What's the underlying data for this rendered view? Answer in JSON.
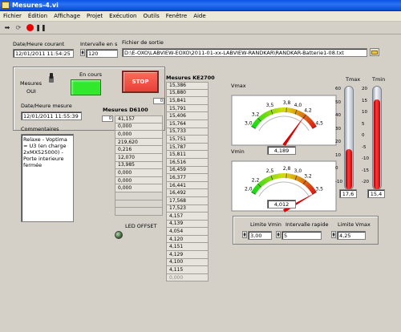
{
  "window": {
    "title": "Mesures-4.vi"
  },
  "menu": [
    "Fichier",
    "Édition",
    "Affichage",
    "Projet",
    "Exécution",
    "Outils",
    "Fenêtre",
    "Aide"
  ],
  "toolbar": {
    "run_icon": "run-arrow-icon",
    "continuous_icon": "continuous-run-icon",
    "abort_icon": "abort-icon",
    "pause_icon": "pause-icon"
  },
  "top": {
    "date_label": "Date/Heure courant",
    "date_value": "12/01/2011 11:54:25",
    "interval_label": "Intervalle en s",
    "interval_value": "120",
    "file_label": "Fichier de sortie",
    "file_value": "D:\\E-OXO\\LABVIEW-EOXO\\2011-01-xx-LABVIEW-RANDKAR\\RANDKAR-Batterie1-08.txt"
  },
  "left": {
    "mesures_label": "Mesures",
    "mesures_state": "OUI",
    "en_cours_label": "En cours",
    "stop_label": "STOP",
    "date_mesure_label": "Date/Heure mesure",
    "date_mesure_value": "12/01/2011 11:55:39",
    "comments_label": "Commentaires",
    "comments_text": "Relaxe - Voptima = U3 (en charge 2xMX525000) - Porte interieure fermée",
    "led_offset_label": "LED OFFSET"
  },
  "d6100": {
    "label": "Mesures D6100",
    "index": "0",
    "values": [
      "41,157",
      "0,000",
      "0,000",
      "219,620",
      "0,216",
      "12,070",
      "13,985",
      "0,000",
      "0,000",
      "0,000",
      "",
      "",
      ""
    ]
  },
  "ke2700": {
    "label": "Mesures KE2700",
    "index": "0",
    "values": [
      "15,386",
      "15,880",
      "15,841",
      "15,791",
      "15,406",
      "15,764",
      "15,733",
      "15,751",
      "15,787",
      "15,811",
      "16,516",
      "16,459",
      "16,377",
      "16,441",
      "16,492",
      "17,568",
      "17,523",
      "4,157",
      "4,139",
      "4,054",
      "4,120",
      "4,151",
      "4,129",
      "4,100",
      "4,115",
      "0,000"
    ]
  },
  "vmax": {
    "label": "Vmax",
    "ticks": [
      "3,0",
      "3,2",
      "3,5",
      "3,8",
      "4,0",
      "4,2",
      "4,5"
    ],
    "value": "4,189",
    "range": [
      3.0,
      4.5
    ],
    "needle": 4.189
  },
  "vmin": {
    "label": "Vmin",
    "ticks": [
      "2,0",
      "2,2",
      "2,5",
      "2,8",
      "3,0",
      "3,2",
      "3,5"
    ],
    "value": "4,012",
    "range": [
      2.0,
      3.5
    ],
    "needle": 3.5
  },
  "tmax": {
    "label": "Tmax",
    "ticks": [
      "60",
      "50",
      "40",
      "30",
      "20",
      "10",
      "0",
      "-10"
    ],
    "value": "17,6",
    "range": [
      -10,
      60
    ],
    "level": 17.6
  },
  "tmin": {
    "label": "Tmin",
    "ticks": [
      "20",
      "15",
      "10",
      "5",
      "0",
      "-5",
      "-10",
      "-15",
      "-20"
    ],
    "value": "15,4",
    "range": [
      -20,
      20
    ],
    "level": 15.4
  },
  "limits": {
    "vmin_label": "Limite Vmin",
    "vmin_value": "3,00",
    "rapide_label": "Intervalle rapide",
    "rapide_value": "5",
    "vmax_label": "Limite Vmax",
    "vmax_value": "4,25"
  },
  "colors": {
    "titlebar": "#0a54e6",
    "led_on": "#31e82c",
    "stop": "#e8413a",
    "thermo_fill": "#e00000"
  }
}
